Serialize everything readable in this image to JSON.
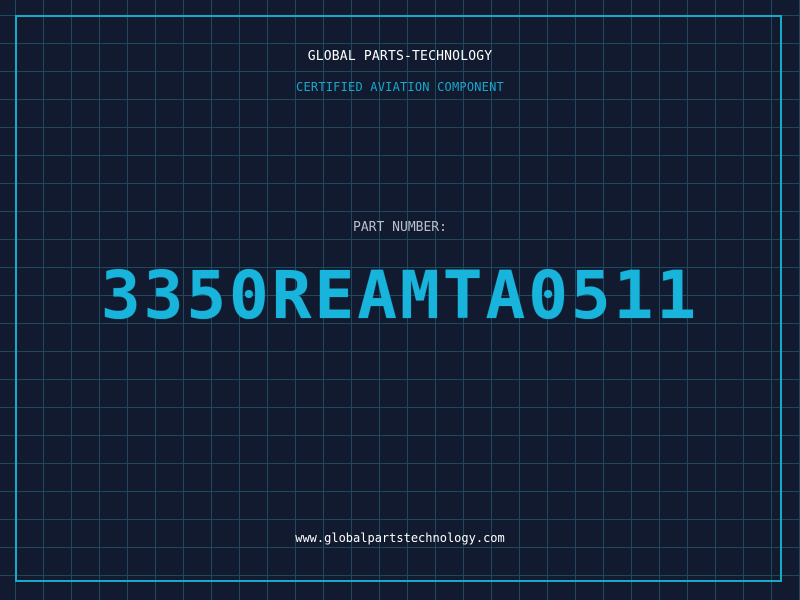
{
  "header": {
    "company": "GLOBAL PARTS-TECHNOLOGY",
    "certification": "CERTIFIED AVIATION COMPONENT"
  },
  "part": {
    "label": "PART NUMBER:",
    "number": "3350REAMTA0511"
  },
  "footer": {
    "website": "www.globalpartstechnology.com"
  },
  "colors": {
    "background": "#111a2e",
    "grid": "#1f4a5e",
    "accent": "#18b4dc",
    "frame": "#18a8c8"
  }
}
